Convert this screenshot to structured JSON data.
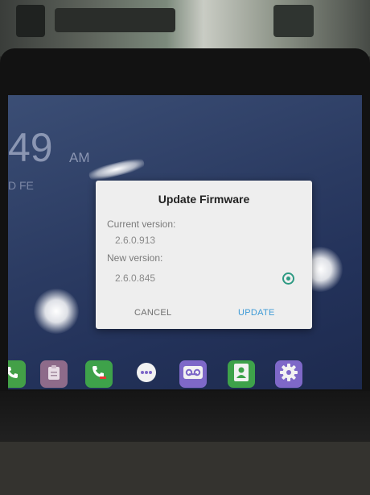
{
  "dialog": {
    "title": "Update Firmware",
    "current_version_label": "Current version:",
    "current_version_value": "2.6.0.913",
    "new_version_label": "New version:",
    "new_version_value": "2.6.0.845",
    "new_version_selected": true,
    "cancel_label": "CANCEL",
    "update_label": "UPDATE"
  },
  "home": {
    "clock_minutes": "49",
    "clock_ampm": "AM",
    "date_fragment": "D FE"
  },
  "dock": {
    "apps": [
      {
        "icon": "phone-icon",
        "color": "#43a047"
      },
      {
        "icon": "clipboard-icon",
        "color": "#8e6b8a"
      },
      {
        "icon": "call-log-icon",
        "color": "#3ea24a"
      },
      {
        "icon": "app-drawer-icon",
        "color": "#7e68c8"
      },
      {
        "icon": "voicemail-icon",
        "color": "#7e68c8"
      },
      {
        "icon": "contacts-icon",
        "color": "#3ea24a"
      },
      {
        "icon": "settings-icon",
        "color": "#7e68c8"
      }
    ]
  },
  "colors": {
    "accent": "#2e9a83",
    "update_button": "#3d9ad6",
    "dialog_background": "#eeeeee"
  }
}
